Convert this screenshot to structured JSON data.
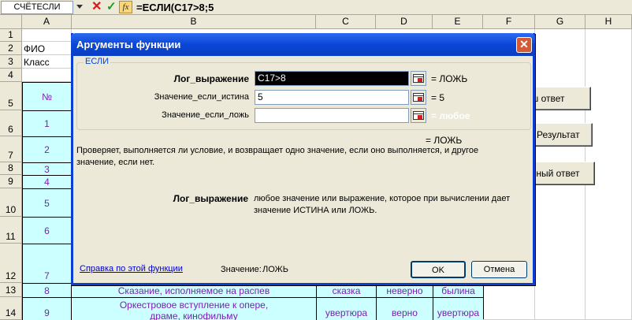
{
  "formula_bar": {
    "name_box": "СЧЁТЕСЛИ",
    "formula": "=ЕСЛИ(C17>8;5"
  },
  "sheet": {
    "columns": [
      "A",
      "B",
      "C",
      "D",
      "E",
      "F",
      "G",
      "H"
    ],
    "rows": [
      "1",
      "2",
      "3",
      "4",
      "5",
      "6",
      "7",
      "8",
      "9",
      "10",
      "11",
      "12",
      "13",
      "14"
    ],
    "a2": "ФИО",
    "a3": "Класс",
    "a5": "№",
    "row_numbers": [
      "1",
      "2",
      "3",
      "4",
      "5",
      "6",
      "7",
      "8",
      "9"
    ],
    "row13": {
      "b": "Сказание, исполняемое на распев",
      "c": "сказка",
      "d": "неверно",
      "e": "былина"
    },
    "row14": {
      "b": "Оркестровое вступление к опере, драме, кинофильму",
      "c": "увертюра",
      "d": "верно",
      "e": "увертюра"
    },
    "buttons": {
      "your_answer": "аш ответ",
      "result": "Результат",
      "correct_answer": "ерный ответ"
    }
  },
  "dialog": {
    "title": "Аргументы функции",
    "function_name": "ЕСЛИ",
    "args": [
      {
        "label": "Лог_выражение",
        "value": "C17>8",
        "result": "= ЛОЖЬ"
      },
      {
        "label": "Значение_если_истина",
        "value": "5",
        "result": "= 5"
      },
      {
        "label": "Значение_если_ложь",
        "value": "",
        "result": "= любое"
      }
    ],
    "overall_result": "= ЛОЖЬ",
    "description": "Проверяет, выполняется ли условие, и возвращает одно значение, если оно выполняется, и другое значение, если нет.",
    "arg_help_name": "Лог_выражение",
    "arg_help_text": "любое значение или выражение, которое при вычислении дает значение ИСТИНА или ЛОЖЬ.",
    "help_link": "Справка по этой функции",
    "value_label": "Значение:",
    "value": "ЛОЖЬ",
    "ok_label": "OK",
    "cancel_label": "Отмена"
  }
}
